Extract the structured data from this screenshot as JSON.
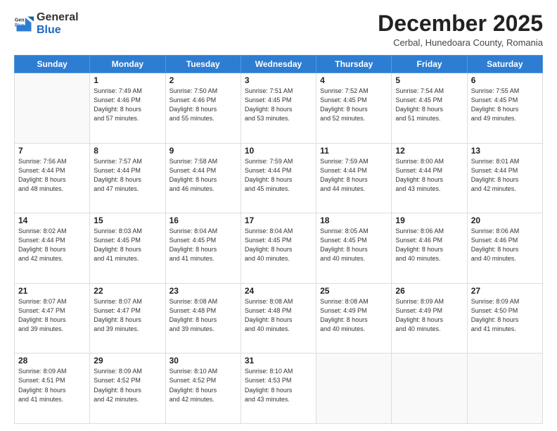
{
  "header": {
    "logo_general": "General",
    "logo_blue": "Blue",
    "month_title": "December 2025",
    "subtitle": "Cerbal, Hunedoara County, Romania"
  },
  "days_of_week": [
    "Sunday",
    "Monday",
    "Tuesday",
    "Wednesday",
    "Thursday",
    "Friday",
    "Saturday"
  ],
  "weeks": [
    [
      {
        "day": "",
        "info": ""
      },
      {
        "day": "1",
        "info": "Sunrise: 7:49 AM\nSunset: 4:46 PM\nDaylight: 8 hours\nand 57 minutes."
      },
      {
        "day": "2",
        "info": "Sunrise: 7:50 AM\nSunset: 4:46 PM\nDaylight: 8 hours\nand 55 minutes."
      },
      {
        "day": "3",
        "info": "Sunrise: 7:51 AM\nSunset: 4:45 PM\nDaylight: 8 hours\nand 53 minutes."
      },
      {
        "day": "4",
        "info": "Sunrise: 7:52 AM\nSunset: 4:45 PM\nDaylight: 8 hours\nand 52 minutes."
      },
      {
        "day": "5",
        "info": "Sunrise: 7:54 AM\nSunset: 4:45 PM\nDaylight: 8 hours\nand 51 minutes."
      },
      {
        "day": "6",
        "info": "Sunrise: 7:55 AM\nSunset: 4:45 PM\nDaylight: 8 hours\nand 49 minutes."
      }
    ],
    [
      {
        "day": "7",
        "info": "Sunrise: 7:56 AM\nSunset: 4:44 PM\nDaylight: 8 hours\nand 48 minutes."
      },
      {
        "day": "8",
        "info": "Sunrise: 7:57 AM\nSunset: 4:44 PM\nDaylight: 8 hours\nand 47 minutes."
      },
      {
        "day": "9",
        "info": "Sunrise: 7:58 AM\nSunset: 4:44 PM\nDaylight: 8 hours\nand 46 minutes."
      },
      {
        "day": "10",
        "info": "Sunrise: 7:59 AM\nSunset: 4:44 PM\nDaylight: 8 hours\nand 45 minutes."
      },
      {
        "day": "11",
        "info": "Sunrise: 7:59 AM\nSunset: 4:44 PM\nDaylight: 8 hours\nand 44 minutes."
      },
      {
        "day": "12",
        "info": "Sunrise: 8:00 AM\nSunset: 4:44 PM\nDaylight: 8 hours\nand 43 minutes."
      },
      {
        "day": "13",
        "info": "Sunrise: 8:01 AM\nSunset: 4:44 PM\nDaylight: 8 hours\nand 42 minutes."
      }
    ],
    [
      {
        "day": "14",
        "info": "Sunrise: 8:02 AM\nSunset: 4:44 PM\nDaylight: 8 hours\nand 42 minutes."
      },
      {
        "day": "15",
        "info": "Sunrise: 8:03 AM\nSunset: 4:45 PM\nDaylight: 8 hours\nand 41 minutes."
      },
      {
        "day": "16",
        "info": "Sunrise: 8:04 AM\nSunset: 4:45 PM\nDaylight: 8 hours\nand 41 minutes."
      },
      {
        "day": "17",
        "info": "Sunrise: 8:04 AM\nSunset: 4:45 PM\nDaylight: 8 hours\nand 40 minutes."
      },
      {
        "day": "18",
        "info": "Sunrise: 8:05 AM\nSunset: 4:45 PM\nDaylight: 8 hours\nand 40 minutes."
      },
      {
        "day": "19",
        "info": "Sunrise: 8:06 AM\nSunset: 4:46 PM\nDaylight: 8 hours\nand 40 minutes."
      },
      {
        "day": "20",
        "info": "Sunrise: 8:06 AM\nSunset: 4:46 PM\nDaylight: 8 hours\nand 40 minutes."
      }
    ],
    [
      {
        "day": "21",
        "info": "Sunrise: 8:07 AM\nSunset: 4:47 PM\nDaylight: 8 hours\nand 39 minutes."
      },
      {
        "day": "22",
        "info": "Sunrise: 8:07 AM\nSunset: 4:47 PM\nDaylight: 8 hours\nand 39 minutes."
      },
      {
        "day": "23",
        "info": "Sunrise: 8:08 AM\nSunset: 4:48 PM\nDaylight: 8 hours\nand 39 minutes."
      },
      {
        "day": "24",
        "info": "Sunrise: 8:08 AM\nSunset: 4:48 PM\nDaylight: 8 hours\nand 40 minutes."
      },
      {
        "day": "25",
        "info": "Sunrise: 8:08 AM\nSunset: 4:49 PM\nDaylight: 8 hours\nand 40 minutes."
      },
      {
        "day": "26",
        "info": "Sunrise: 8:09 AM\nSunset: 4:49 PM\nDaylight: 8 hours\nand 40 minutes."
      },
      {
        "day": "27",
        "info": "Sunrise: 8:09 AM\nSunset: 4:50 PM\nDaylight: 8 hours\nand 41 minutes."
      }
    ],
    [
      {
        "day": "28",
        "info": "Sunrise: 8:09 AM\nSunset: 4:51 PM\nDaylight: 8 hours\nand 41 minutes."
      },
      {
        "day": "29",
        "info": "Sunrise: 8:09 AM\nSunset: 4:52 PM\nDaylight: 8 hours\nand 42 minutes."
      },
      {
        "day": "30",
        "info": "Sunrise: 8:10 AM\nSunset: 4:52 PM\nDaylight: 8 hours\nand 42 minutes."
      },
      {
        "day": "31",
        "info": "Sunrise: 8:10 AM\nSunset: 4:53 PM\nDaylight: 8 hours\nand 43 minutes."
      },
      {
        "day": "",
        "info": ""
      },
      {
        "day": "",
        "info": ""
      },
      {
        "day": "",
        "info": ""
      }
    ]
  ]
}
